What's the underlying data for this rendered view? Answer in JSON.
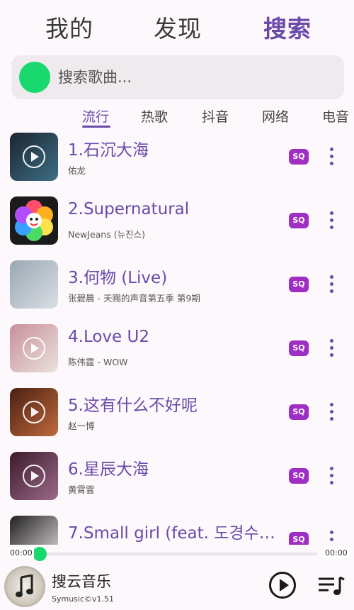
{
  "top_tabs": [
    {
      "label": "我的",
      "active": false
    },
    {
      "label": "发现",
      "active": false
    },
    {
      "label": "搜索",
      "active": true
    }
  ],
  "search": {
    "placeholder": "搜索歌曲..."
  },
  "categories": [
    {
      "label": "流行",
      "active": true
    },
    {
      "label": "热歌",
      "active": false
    },
    {
      "label": "抖音",
      "active": false
    },
    {
      "label": "网络",
      "active": false
    },
    {
      "label": "电音",
      "active": false
    }
  ],
  "songs": [
    {
      "title": "1.石沉大海",
      "artist": "佑龙",
      "badge": "SQ",
      "cover_colors": [
        "#1c2430",
        "#3d6f86"
      ]
    },
    {
      "title": "2.Supernatural",
      "artist": "NewJeans (뉴진스)",
      "badge": "SQ",
      "cover_colors": [
        "#222222",
        "#e83c8a"
      ]
    },
    {
      "title": "3.何物 (Live)",
      "artist": "张碧晨 - 天赐的声音第五季 第9期",
      "badge": "SQ",
      "cover_colors": [
        "#9aa7b3",
        "#d9dfe4"
      ]
    },
    {
      "title": "4.Love U2",
      "artist": "陈伟霆 - WOW",
      "badge": "SQ",
      "cover_colors": [
        "#c98f9a",
        "#e9e2dc"
      ]
    },
    {
      "title": "5.这有什么不好呢",
      "artist": "赵一博",
      "badge": "SQ",
      "cover_colors": [
        "#4a1f12",
        "#c06a3c"
      ]
    },
    {
      "title": "6.星辰大海",
      "artist": "黄霄雲",
      "badge": "SQ",
      "cover_colors": [
        "#3b1a2a",
        "#9c6a8a"
      ]
    },
    {
      "title": "7.Small girl (feat. 도경수(…",
      "artist": "",
      "badge": "SQ",
      "cover_colors": [
        "#1f1f1f",
        "#e7dfe0"
      ]
    }
  ],
  "player": {
    "time_current": "00:00",
    "time_total": "00:00",
    "progress": 0,
    "title": "搜云音乐",
    "version": "Symusic©v1.51"
  },
  "colors": {
    "accent": "#6a4aa8",
    "green": "#19d86e",
    "badge": "#9f2fc4"
  }
}
